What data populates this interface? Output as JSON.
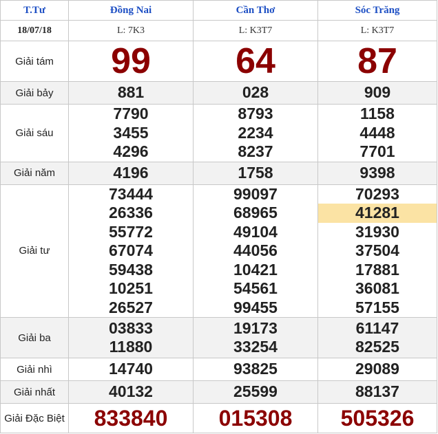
{
  "header": {
    "col_label": "T.Tư",
    "provinces": [
      "Đồng Nai",
      "Cần Thơ",
      "Sóc Trăng"
    ]
  },
  "subheader": {
    "date": "18/07/18",
    "codes": [
      "L: 7K3",
      "L: K3T7",
      "L: K3T7"
    ]
  },
  "prizes": {
    "g8": {
      "label": "Giải tám",
      "values": [
        [
          "99"
        ],
        [
          "64"
        ],
        [
          "87"
        ]
      ]
    },
    "g7": {
      "label": "Giải bảy",
      "values": [
        [
          "881"
        ],
        [
          "028"
        ],
        [
          "909"
        ]
      ]
    },
    "g6": {
      "label": "Giải sáu",
      "values": [
        [
          "7790",
          "3455",
          "4296"
        ],
        [
          "8793",
          "2234",
          "8237"
        ],
        [
          "1158",
          "4448",
          "7701"
        ]
      ]
    },
    "g5": {
      "label": "Giải năm",
      "values": [
        [
          "4196"
        ],
        [
          "1758"
        ],
        [
          "9398"
        ]
      ]
    },
    "g4": {
      "label": "Giải tư",
      "values": [
        [
          "73444",
          "26336",
          "55772",
          "67074",
          "59438",
          "10251",
          "26527"
        ],
        [
          "99097",
          "68965",
          "49104",
          "44056",
          "10421",
          "54561",
          "99455"
        ],
        [
          "70293",
          "41281",
          "31930",
          "37504",
          "17881",
          "36081",
          "57155"
        ]
      ]
    },
    "g3": {
      "label": "Giải ba",
      "values": [
        [
          "03833",
          "11880"
        ],
        [
          "19173",
          "33254"
        ],
        [
          "61147",
          "82525"
        ]
      ]
    },
    "g2": {
      "label": "Giải nhì",
      "values": [
        [
          "14740"
        ],
        [
          "93825"
        ],
        [
          "29089"
        ]
      ]
    },
    "g1": {
      "label": "Giải nhất",
      "values": [
        [
          "40132"
        ],
        [
          "25599"
        ],
        [
          "88137"
        ]
      ]
    },
    "db": {
      "label": "Giải Đặc Biệt",
      "values": [
        [
          "833840"
        ],
        [
          "015308"
        ],
        [
          "505326"
        ]
      ]
    }
  },
  "highlight": {
    "prize": "g4",
    "column": 2,
    "index": 1
  },
  "colors": {
    "accent_number": "#8b0000",
    "header_text": "#1d4fc4",
    "highlight": "#fbe3a4"
  }
}
